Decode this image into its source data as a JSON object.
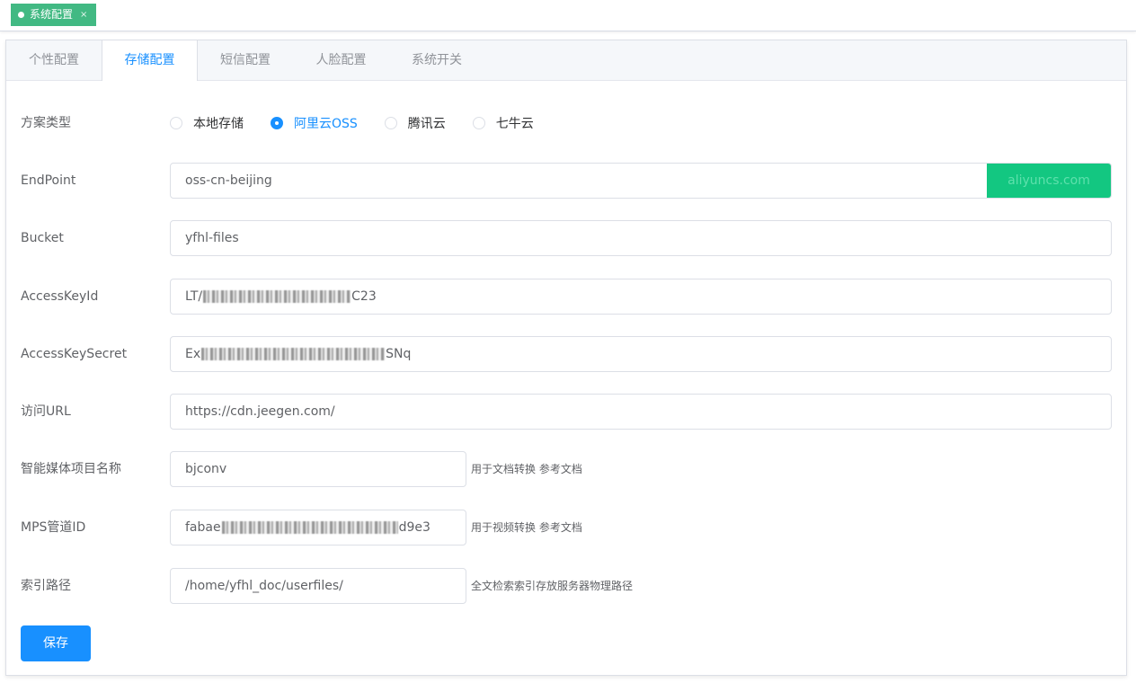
{
  "tagsView": {
    "active_tag": "系统配置",
    "close_symbol": "×"
  },
  "tabs": [
    {
      "label": "个性配置"
    },
    {
      "label": "存储配置"
    },
    {
      "label": "短信配置"
    },
    {
      "label": "人脸配置"
    },
    {
      "label": "系统开关"
    }
  ],
  "active_tab": "存储配置",
  "form": {
    "scheme": {
      "label": "方案类型",
      "options": [
        "本地存储",
        "阿里云OSS",
        "腾讯云",
        "七牛云"
      ],
      "selected": "阿里云OSS"
    },
    "endpoint": {
      "label": "EndPoint",
      "value": "oss-cn-beijing",
      "append": "aliyuncs.com"
    },
    "bucket": {
      "label": "Bucket",
      "value": "yfhl-files"
    },
    "access_key_id": {
      "label": "AccessKeyId",
      "value_start": "LT/",
      "value_end": "C23"
    },
    "access_key_secret": {
      "label": "AccessKeySecret",
      "value_start": "Ex",
      "value_end": "SNq"
    },
    "access_url": {
      "label": "访问URL",
      "value": "https://cdn.jeegen.com/"
    },
    "media_project": {
      "label": "智能媒体项目名称",
      "value": "bjconv",
      "hint": "用于文档转换 参考文档"
    },
    "mps_pipeline": {
      "label": "MPS管道ID",
      "value_start": "fabae",
      "value_end": "d9e3",
      "hint": "用于视频转换 参考文档"
    },
    "index_path": {
      "label": "索引路径",
      "value": "/home/yfhl_doc/userfiles/",
      "hint": "全文检索索引存放服务器物理路径"
    }
  },
  "save_label": "保存",
  "colors": {
    "primary": "#1890ff",
    "tag_green": "#42b983",
    "append_green": "#13c781"
  }
}
